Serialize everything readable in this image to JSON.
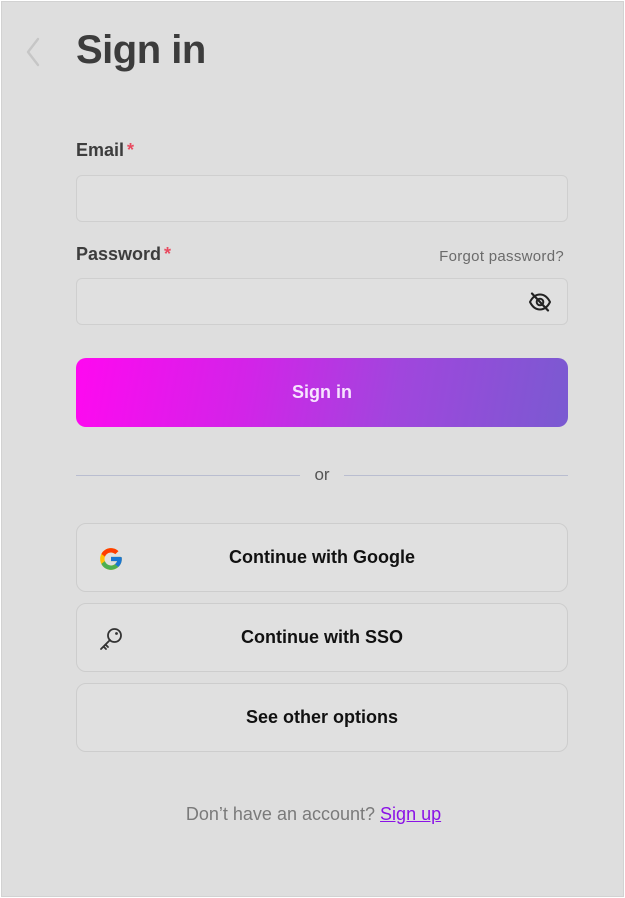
{
  "header": {
    "back_icon": "chevron-left-icon",
    "title": "Sign in"
  },
  "form": {
    "email": {
      "label": "Email",
      "required_mark": "*",
      "value": ""
    },
    "password": {
      "label": "Password",
      "required_mark": "*",
      "value": "",
      "forgot_link": "Forgot password?",
      "toggle_icon": "eye-off-icon"
    },
    "submit_label": "Sign in"
  },
  "divider": {
    "label": "or"
  },
  "alt_options": {
    "google_label": "Continue with Google",
    "google_icon": "google-icon",
    "sso_label": "Continue with SSO",
    "sso_icon": "key-icon",
    "other_label": "See other options"
  },
  "footer": {
    "prompt": "Don’t have an account?",
    "signup_link": "Sign up"
  },
  "colors": {
    "background": "#dedede",
    "gradient_start": "#ff08f0",
    "gradient_end": "#7a5ad1",
    "required": "#e84a5f",
    "link": "#8a12e6"
  }
}
